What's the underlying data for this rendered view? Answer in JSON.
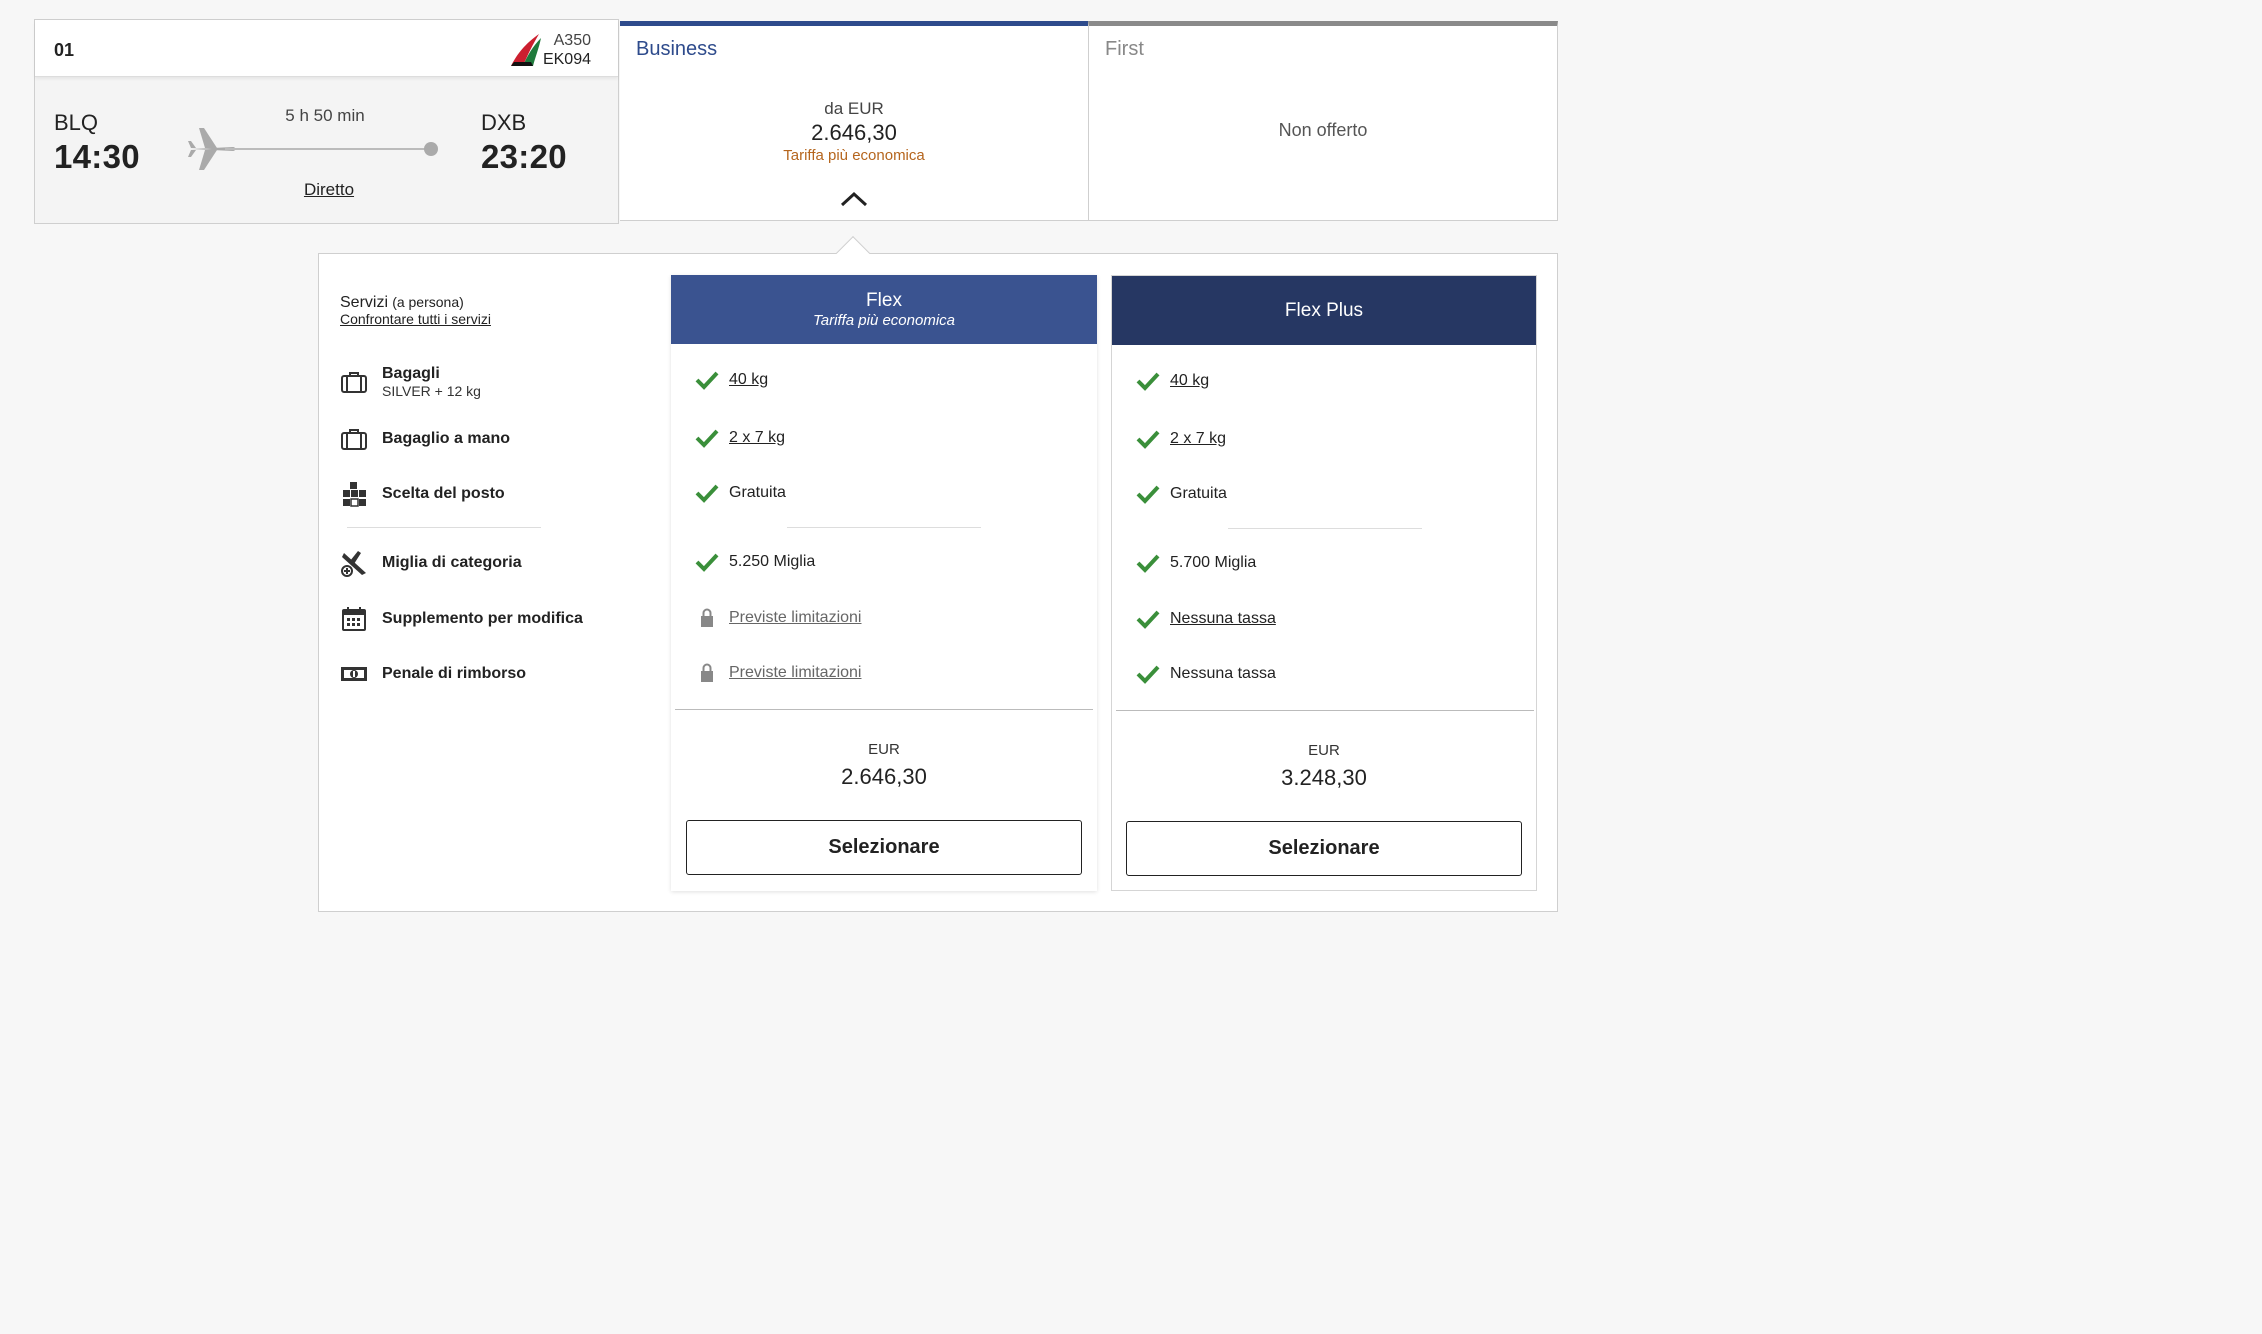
{
  "flight": {
    "number": "01",
    "aircraft": "A350",
    "flight_code": "EK094",
    "origin": {
      "code": "BLQ",
      "time": "14:30"
    },
    "destination": {
      "code": "DXB",
      "time": "23:20"
    },
    "duration": "5 h 50 min",
    "stops": "Diretto"
  },
  "cabins": {
    "business": {
      "name": "Business",
      "from": "da EUR",
      "price": "2.646,30",
      "note": "Tariffa più economica",
      "accent": "#2e4b8c"
    },
    "first": {
      "name": "First",
      "status": "Non offerto"
    }
  },
  "services": {
    "title": "Servizi",
    "per_person": "(a persona)",
    "compare_link": "Confrontare tutti i servizi",
    "items": [
      {
        "label": "Bagagli",
        "sub": "SILVER + 12 kg",
        "icon": "suitcase-icon"
      },
      {
        "label": "Bagaglio a mano",
        "icon": "hand-luggage-icon"
      },
      {
        "label": "Scelta del posto",
        "icon": "seat-map-icon"
      },
      {
        "label": "Miglia di categoria",
        "icon": "miles-plane-icon"
      },
      {
        "label": "Supplemento per modifica",
        "icon": "calendar-icon"
      },
      {
        "label": "Penale di rimborso",
        "icon": "banknote-icon"
      }
    ]
  },
  "fares": {
    "flex": {
      "name": "Flex",
      "subtitle": "Tariffa più economica",
      "color": "#3a5390",
      "rows": [
        "40 kg",
        "2 x 7 kg",
        "Gratuita",
        "5.250 Miglia",
        "Previste limitazioni",
        "Previste limitazioni"
      ],
      "currency": "EUR",
      "price": "2.646,30",
      "button": "Selezionare"
    },
    "flex_plus": {
      "name": "Flex Plus",
      "color": "#263763",
      "rows": [
        "40 kg",
        "2 x 7 kg",
        "Gratuita",
        "5.700 Miglia",
        "Nessuna tassa",
        "Nessuna tassa"
      ],
      "currency": "EUR",
      "price": "3.248,30",
      "button": "Selezionare"
    }
  },
  "colors": {
    "check": "#3a8f3a",
    "lock": "#888888",
    "note": "#b5651d"
  }
}
